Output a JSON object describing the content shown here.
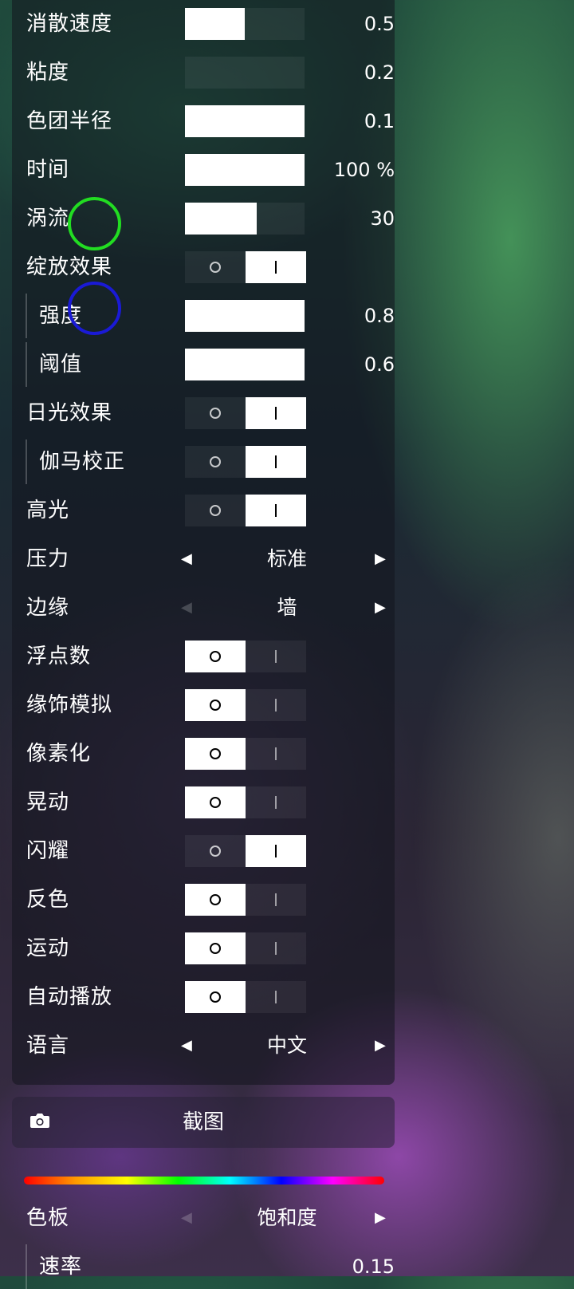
{
  "settings": {
    "dissipation": {
      "label": "消散速度",
      "value": "0.5",
      "level": 0.5
    },
    "viscosity": {
      "label": "粘度",
      "value": "0.2",
      "level": 0.0
    },
    "splat_radius": {
      "label": "色团半径",
      "value": "0.1",
      "level": 1.0
    },
    "time": {
      "label": "时间",
      "value": "100 %",
      "level": 1.0
    },
    "curl": {
      "label": "涡流",
      "value": "30",
      "level": 0.6
    },
    "bloom": {
      "label": "绽放效果",
      "on": true
    },
    "bloom_intensity": {
      "label": "强度",
      "value": "0.8",
      "level": 1.0
    },
    "bloom_threshold": {
      "label": "阈值",
      "value": "0.6",
      "level": 1.0
    },
    "sunrays": {
      "label": "日光效果",
      "on": true
    },
    "gamma": {
      "label": "伽马校正",
      "on": true
    },
    "highlight": {
      "label": "高光",
      "on": true
    },
    "pressure": {
      "label": "压力",
      "value": "标准"
    },
    "edge": {
      "label": "边缘",
      "value": "墙"
    },
    "float": {
      "label": "浮点数",
      "on": false
    },
    "ornament": {
      "label": "缘饰模拟",
      "on": false
    },
    "pixelate": {
      "label": "像素化",
      "on": false
    },
    "shake": {
      "label": "晃动",
      "on": false
    },
    "sparkle": {
      "label": "闪耀",
      "on": true
    },
    "invert": {
      "label": "反色",
      "on": false
    },
    "motion": {
      "label": "运动",
      "on": false
    },
    "autoplay": {
      "label": "自动播放",
      "on": false
    },
    "language": {
      "label": "语言",
      "value": "中文"
    }
  },
  "screenshot": {
    "label": "截图",
    "icon": "camera-icon"
  },
  "palette": {
    "label": "色板",
    "value": "饱和度"
  },
  "rate": {
    "label": "速率",
    "value": "0.15"
  },
  "glyphs": {
    "left": "◀",
    "right": "▶"
  },
  "touch_markers": {
    "green": "#22dd22",
    "blue": "#1a1ad6"
  }
}
